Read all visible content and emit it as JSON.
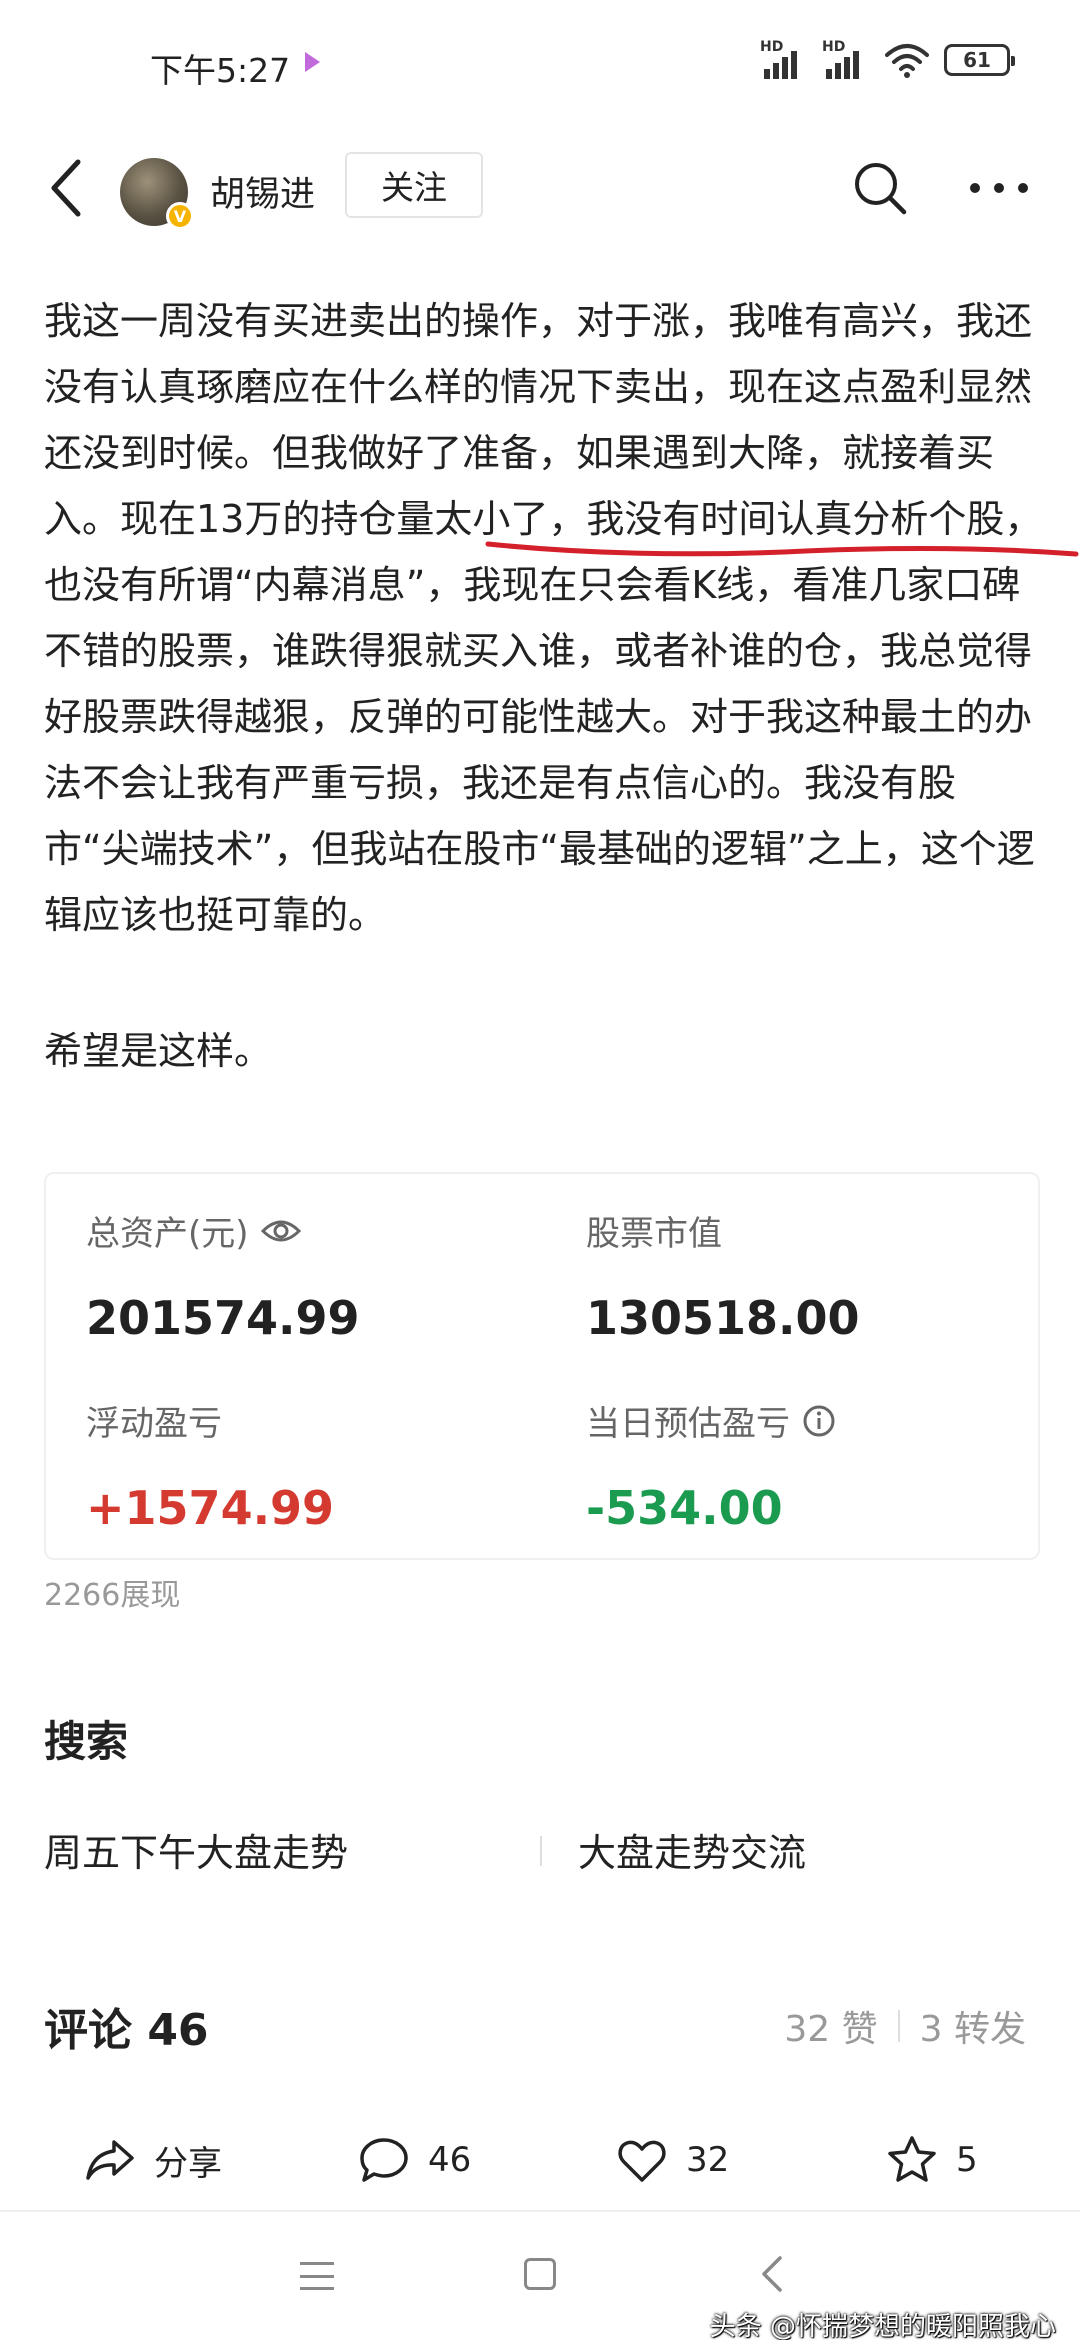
{
  "status_bar": {
    "time": "下午5:27",
    "hd_label": "HD",
    "battery": "61"
  },
  "header": {
    "author_name": "胡锡进",
    "follow_label": "关注"
  },
  "article": {
    "paragraph_1": "我这一周没有买进卖出的操作，对于涨，我唯有高兴，我还没有认真琢磨应在什么样的情况下卖出，现在这点盈利显然还没到时候。但我做好了准备，如果遇到大降，就接着买入。现在13万的持仓量太小了，我没有时间认真分析个股，也没有所谓“内幕消息”，我现在只会看K线，看准几家口碑不错的股票，谁跌得狠就买入谁，或者补谁的仓，我总觉得好股票跌得越狠，反弹的可能性越大。对于我这种最土的办法不会让我有严重亏损，我还是有点信心的。我没有股市“尖端技术”，但我站在股市“最基础的逻辑”之上，这个逻辑应该也挺可靠的。",
    "paragraph_2": "希望是这样。"
  },
  "asset_card": {
    "total_assets_label": "总资产(元)",
    "total_assets_value": "201574.99",
    "market_value_label": "股票市值",
    "market_value_value": "130518.00",
    "floating_pl_label": "浮动盈亏",
    "floating_pl_value": "+1574.99",
    "daily_pl_label": "当日预估盈亏",
    "daily_pl_value": "-534.00",
    "colors": {
      "positive": "#d43a30",
      "negative": "#1a9b50"
    }
  },
  "views": "2266展现",
  "search": {
    "title": "搜索",
    "links": [
      "周五下午大盘走势",
      "大盘走势交流"
    ]
  },
  "comments": {
    "title": "评论 46",
    "likes": "32 赞",
    "reposts": "3 转发"
  },
  "actions": {
    "share_label": "分享",
    "comment_count": "46",
    "like_count": "32",
    "favorite_count": "5"
  },
  "watermark": "头条 @怀揣梦想的暖阳照我心",
  "accent_colors": {
    "underline": "#d4202a"
  }
}
